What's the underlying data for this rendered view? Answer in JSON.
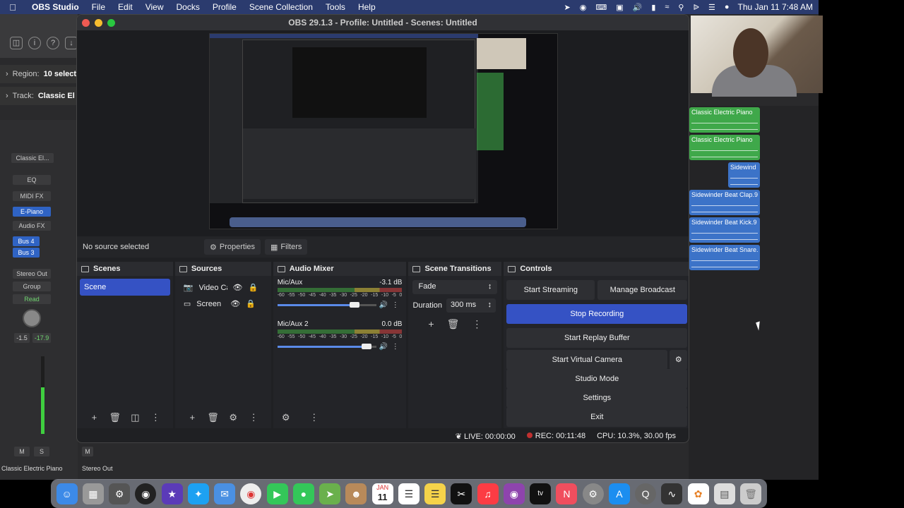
{
  "menubar": {
    "app_name": "OBS Studio",
    "items": [
      "File",
      "Edit",
      "View",
      "Docks",
      "Profile",
      "Scene Collection",
      "Tools",
      "Help"
    ],
    "datetime": "Thu Jan 11  7:48 AM"
  },
  "logic": {
    "region_label": "Region:",
    "region_value": "10 select",
    "track_label": "Track:",
    "track_value": "Classic El",
    "strip": {
      "instrument": "Classic El...",
      "eq": "EQ",
      "midi_fx": "MIDI FX",
      "plugin": "E-Piano",
      "audio_fx": "Audio FX",
      "bus1": "Bus 4",
      "bus2": "Bus 3",
      "output": "Stereo Out",
      "group": "Group",
      "automation": "Read",
      "pan1": "-1.5",
      "pan2": "-17.9",
      "mute": "M",
      "solo": "S",
      "mute2": "M",
      "name1": "Classic Electric Piano",
      "name2": "Stereo Out"
    },
    "regions": [
      {
        "name": "Classic Electric Piano",
        "color": "green"
      },
      {
        "name": "Classic Electric Piano",
        "color": "green"
      },
      {
        "name": "Sidewind",
        "color": "blue"
      },
      {
        "name": "Sidewinder Beat Clap.9",
        "color": "blue"
      },
      {
        "name": "Sidewinder Beat Kick.9",
        "color": "blue"
      },
      {
        "name": "Sidewinder Beat Snare.",
        "color": "blue"
      }
    ]
  },
  "obs": {
    "title": "OBS 29.1.3 - Profile: Untitled - Scenes: Untitled",
    "no_source": "No source selected",
    "properties_btn": "Properties",
    "filters_btn": "Filters",
    "scenes": {
      "header": "Scenes",
      "items": [
        "Scene"
      ]
    },
    "sources": {
      "header": "Sources",
      "items": [
        "Video Ca",
        "Screen"
      ]
    },
    "mixer": {
      "header": "Audio Mixer",
      "scale": [
        "-60",
        "-55",
        "-50",
        "-45",
        "-40",
        "-35",
        "-30",
        "-25",
        "-20",
        "-15",
        "-10",
        "-5",
        "0"
      ],
      "channels": [
        {
          "name": "Mic/Aux",
          "db": "-3.1 dB",
          "level": 0.78
        },
        {
          "name": "Mic/Aux 2",
          "db": "0.0 dB",
          "level": 0.9
        }
      ]
    },
    "transitions": {
      "header": "Scene Transitions",
      "selected": "Fade",
      "duration_label": "Duration",
      "duration_value": "300 ms"
    },
    "controls": {
      "header": "Controls",
      "start_streaming": "Start Streaming",
      "manage_broadcast": "Manage Broadcast",
      "stop_recording": "Stop Recording",
      "start_replay": "Start Replay Buffer",
      "start_virtual_cam": "Start Virtual Camera",
      "studio_mode": "Studio Mode",
      "settings": "Settings",
      "exit": "Exit"
    },
    "status": {
      "live": "LIVE: 00:00:00",
      "rec": "REC: 00:11:48",
      "cpu": "CPU: 10.3%, 30.00 fps"
    }
  },
  "dock": {
    "apps": [
      "finder",
      "launchpad",
      "settings-app",
      "obs",
      "imovie",
      "twitter",
      "mail",
      "chrome",
      "facetime",
      "messages",
      "maps",
      "contacts",
      "calendar",
      "reminders",
      "notes",
      "capcut",
      "music",
      "podcasts",
      "appletv",
      "news",
      "system-prefs",
      "appstore",
      "quicktime",
      "audio",
      "photos",
      "preview",
      "trash"
    ],
    "calendar_month": "JAN",
    "calendar_day": "11"
  }
}
